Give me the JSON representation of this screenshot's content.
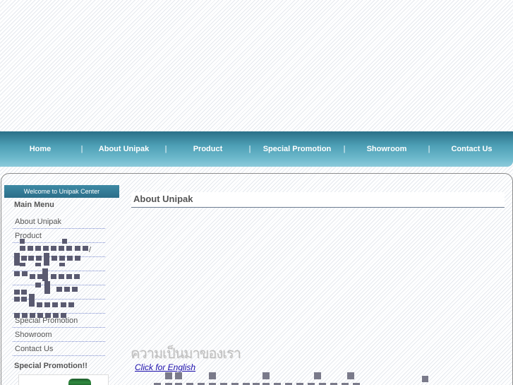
{
  "header": {},
  "nav": {
    "items": [
      {
        "label": "Home"
      },
      {
        "label": "About Unipak"
      },
      {
        "label": "Product"
      },
      {
        "label": "Special Promotion"
      },
      {
        "label": "Showroom"
      },
      {
        "label": "Contact Us"
      }
    ],
    "separator": "|"
  },
  "sidebar": {
    "welcome": "Welcome to Unipak Center",
    "main_menu_title": "Main Menu",
    "menu_items": [
      {
        "label": "About Unipak"
      },
      {
        "label": "Product"
      },
      {
        "label": "/"
      },
      {
        "label": ""
      },
      {
        "label": ""
      },
      {
        "label": ""
      },
      {
        "label": ""
      },
      {
        "label": "Special Promotion"
      },
      {
        "label": "Showroom"
      },
      {
        "label": "Contact Us"
      }
    ],
    "promo_title": "Special Promotion!!"
  },
  "main": {
    "page_title": "About Unipak",
    "thai_heading": "ความเป็นมาของเรา",
    "english_link": "Click for English"
  },
  "colors": {
    "nav_top": "#2a7088",
    "nav_bottom": "#8ccadb",
    "welcome_bar": "#2c6e89",
    "link": "#1a0dab",
    "menu_divider": "#7c8cd0"
  }
}
